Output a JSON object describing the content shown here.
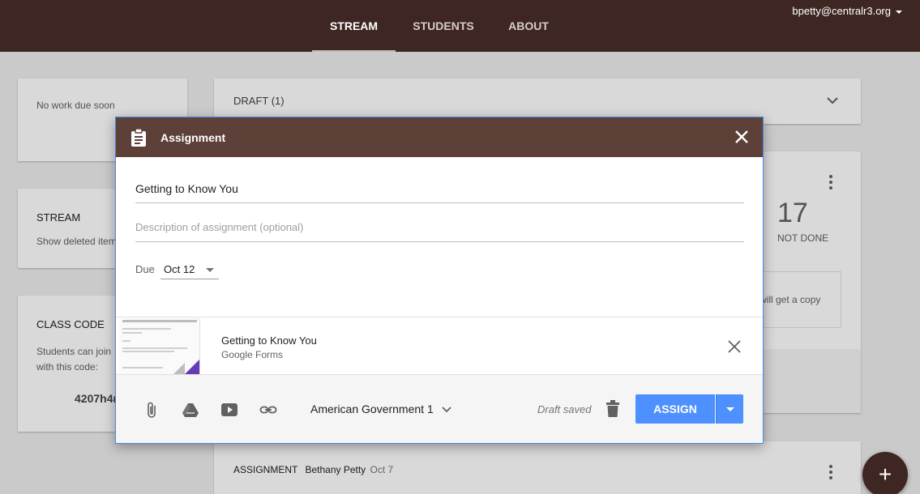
{
  "topbar": {
    "tabs": [
      {
        "label": "STREAM"
      },
      {
        "label": "STUDENTS"
      },
      {
        "label": "ABOUT"
      }
    ],
    "account": "bpetty@centralr3.org"
  },
  "sidebar": {
    "upcoming": "No work due soon",
    "stream_heading": "STREAM",
    "stream_option": "Show deleted item",
    "class_code_heading": "CLASS CODE",
    "class_code_text_1": "Students can join",
    "class_code_text_2": "with this code:",
    "class_code_value": "4207h4r"
  },
  "stream": {
    "draft_label": "DRAFT (1)",
    "not_done_count": "17",
    "not_done_label": "NOT DONE",
    "copy_note": "will get a copy",
    "post_type": "ASSIGNMENT",
    "post_author": "Bethany Petty",
    "post_date": "Oct 7"
  },
  "dialog": {
    "title": "Assignment",
    "title_value": "Getting to Know You",
    "description_placeholder": "Description of assignment (optional)",
    "due_label": "Due",
    "due_value": "Oct 12",
    "attachment": {
      "title": "Getting to Know You",
      "source": "Google Forms"
    },
    "class_name": "American Government 1",
    "status": "Draft saved",
    "assign_label": "ASSIGN"
  },
  "fab_label": "+",
  "colors": {
    "topbar": "#3e2723",
    "dialog_header": "#5d4037",
    "primary_button": "#4d90fe",
    "forms_purple": "#673ab7"
  }
}
